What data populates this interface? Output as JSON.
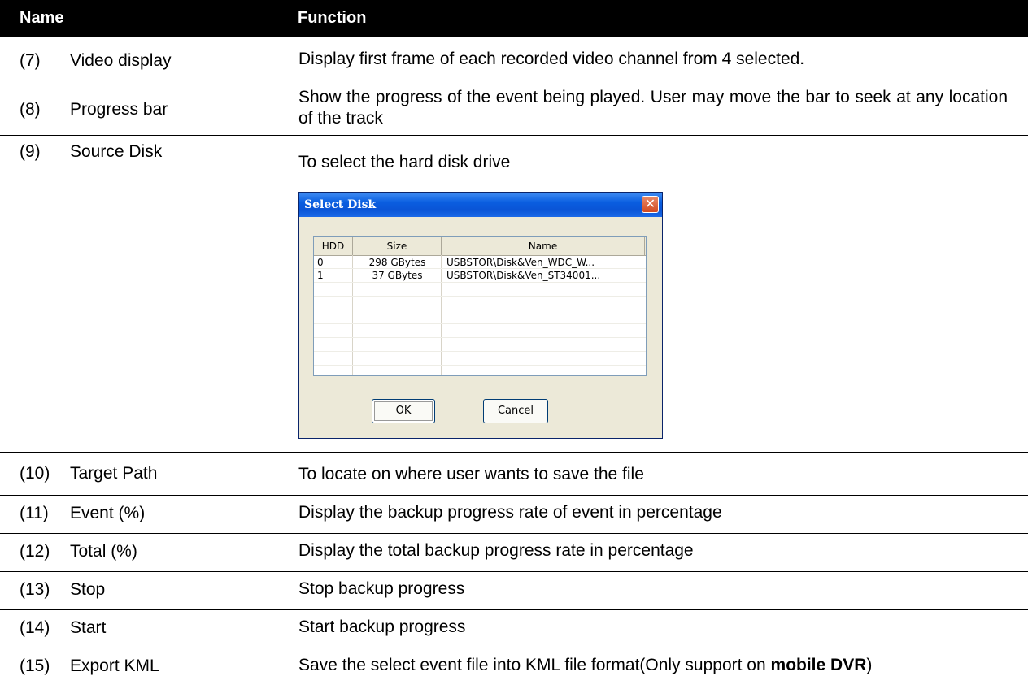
{
  "header": {
    "name": "Name",
    "function": "Function"
  },
  "rows": [
    {
      "num": "(7)",
      "name": "Video display",
      "function": "Display first frame of each recorded video channel from 4 selected."
    },
    {
      "num": "(8)",
      "name": "Progress bar",
      "function": "Show the progress of the event being played. User may move the bar to seek at any location of the track"
    },
    {
      "num": "(9)",
      "name": "Source Disk",
      "function": "To select the hard disk drive"
    },
    {
      "num": "(10)",
      "name": "Target Path",
      "function": "To locate on where user wants to save the file"
    },
    {
      "num": "(11)",
      "name": "Event (%)",
      "function": "Display the backup progress rate of event in percentage"
    },
    {
      "num": "(12)",
      "name": "Total (%)",
      "function": "Display the total backup progress rate in percentage"
    },
    {
      "num": "(13)",
      "name": "Stop",
      "function": "Stop backup progress"
    },
    {
      "num": "(14)",
      "name": "Start",
      "function": "Start backup progress"
    },
    {
      "num": "(15)",
      "name": "Export KML",
      "function_pre": "Save the select event file into KML file format(Only support on ",
      "function_bold": "mobile DVR",
      "function_post": ")"
    }
  ],
  "dialog": {
    "title": "Select Disk",
    "close_glyph": "✕",
    "columns": [
      "HDD",
      "Size",
      "Name"
    ],
    "disks": [
      {
        "hdd": "0",
        "size": "298 GBytes",
        "name": "USBSTOR\\Disk&Ven_WDC_W..."
      },
      {
        "hdd": "1",
        "size": "37 GBytes",
        "name": "USBSTOR\\Disk&Ven_ST34001..."
      }
    ],
    "ok_label": "OK",
    "cancel_label": "Cancel"
  }
}
